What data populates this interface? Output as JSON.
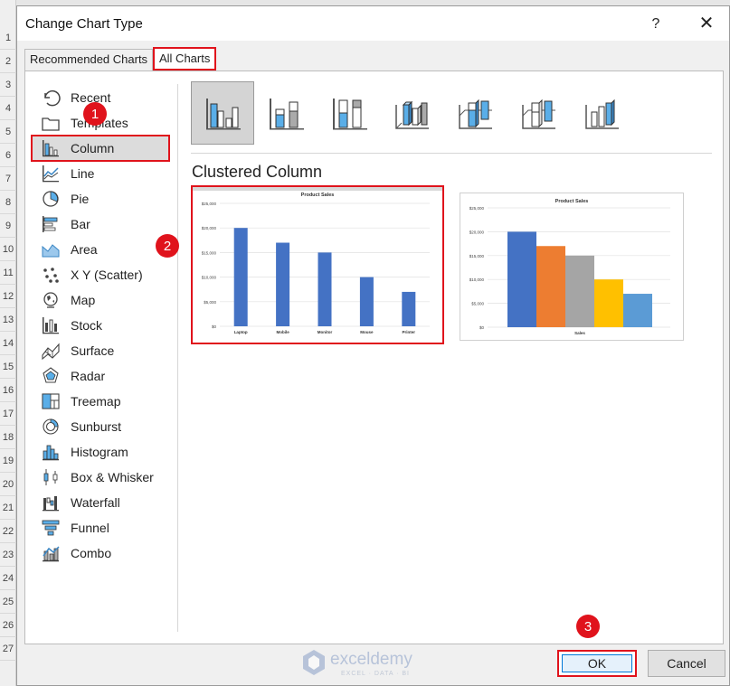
{
  "dialog": {
    "title": "Change Chart Type",
    "help": "?",
    "close": "✕"
  },
  "rows": [
    "1",
    "2",
    "3",
    "4",
    "5",
    "6",
    "7",
    "8",
    "9",
    "10",
    "11",
    "12",
    "13",
    "14",
    "15",
    "16",
    "17",
    "18",
    "19",
    "20",
    "21",
    "22",
    "23",
    "24",
    "25",
    "26",
    "27"
  ],
  "tabs": {
    "recommended": "Recommended Charts",
    "all": "All Charts"
  },
  "sidebar": {
    "items": [
      {
        "label": "Recent",
        "icon": "recent-icon"
      },
      {
        "label": "Templates",
        "icon": "templates-icon"
      },
      {
        "label": "Column",
        "icon": "column-chart-icon",
        "selected": true
      },
      {
        "label": "Line",
        "icon": "line-chart-icon"
      },
      {
        "label": "Pie",
        "icon": "pie-chart-icon"
      },
      {
        "label": "Bar",
        "icon": "bar-chart-icon"
      },
      {
        "label": "Area",
        "icon": "area-chart-icon"
      },
      {
        "label": "X Y (Scatter)",
        "icon": "scatter-chart-icon"
      },
      {
        "label": "Map",
        "icon": "map-chart-icon"
      },
      {
        "label": "Stock",
        "icon": "stock-chart-icon"
      },
      {
        "label": "Surface",
        "icon": "surface-chart-icon"
      },
      {
        "label": "Radar",
        "icon": "radar-chart-icon"
      },
      {
        "label": "Treemap",
        "icon": "treemap-chart-icon"
      },
      {
        "label": "Sunburst",
        "icon": "sunburst-chart-icon"
      },
      {
        "label": "Histogram",
        "icon": "histogram-chart-icon"
      },
      {
        "label": "Box & Whisker",
        "icon": "box-whisker-chart-icon"
      },
      {
        "label": "Waterfall",
        "icon": "waterfall-chart-icon"
      },
      {
        "label": "Funnel",
        "icon": "funnel-chart-icon"
      },
      {
        "label": "Combo",
        "icon": "combo-chart-icon"
      }
    ]
  },
  "subtypes": [
    "Clustered Column",
    "Stacked Column",
    "100% Stacked Column",
    "3-D Clustered Column",
    "3-D Stacked Column",
    "3-D 100% Stacked Column",
    "3-D Column"
  ],
  "section_title": "Clustered Column",
  "chart_data": [
    {
      "type": "bar",
      "title": "Product Sales",
      "categories": [
        "Laptop",
        "Mobile",
        "Monitor",
        "Mouse",
        "Printer"
      ],
      "values": [
        20000,
        17000,
        15000,
        10000,
        7000
      ],
      "yticks": [
        "$0",
        "$5,000",
        "$10,000",
        "$15,000",
        "$20,000",
        "$25,000"
      ],
      "ylim": [
        0,
        25000
      ],
      "color": "#4472c4"
    },
    {
      "type": "bar",
      "title": "Product Sales",
      "categories": [
        "Sales"
      ],
      "series_values": [
        20000,
        17000,
        15000,
        10000,
        7000
      ],
      "series_colors": [
        "#4472c4",
        "#ed7d31",
        "#a5a5a5",
        "#ffc000",
        "#5b9bd5"
      ],
      "yticks": [
        "$0",
        "$5,000",
        "$10,000",
        "$15,000",
        "$20,000",
        "$25,000"
      ],
      "ylim": [
        0,
        25000
      ]
    }
  ],
  "buttons": {
    "ok": "OK",
    "cancel": "Cancel"
  },
  "badges": [
    "1",
    "2",
    "3"
  ],
  "watermark": {
    "name": "exceldemy",
    "tagline": "EXCEL · DATA · BI"
  },
  "colors": {
    "highlight": "#e0131c",
    "accent": "#0078d7"
  }
}
